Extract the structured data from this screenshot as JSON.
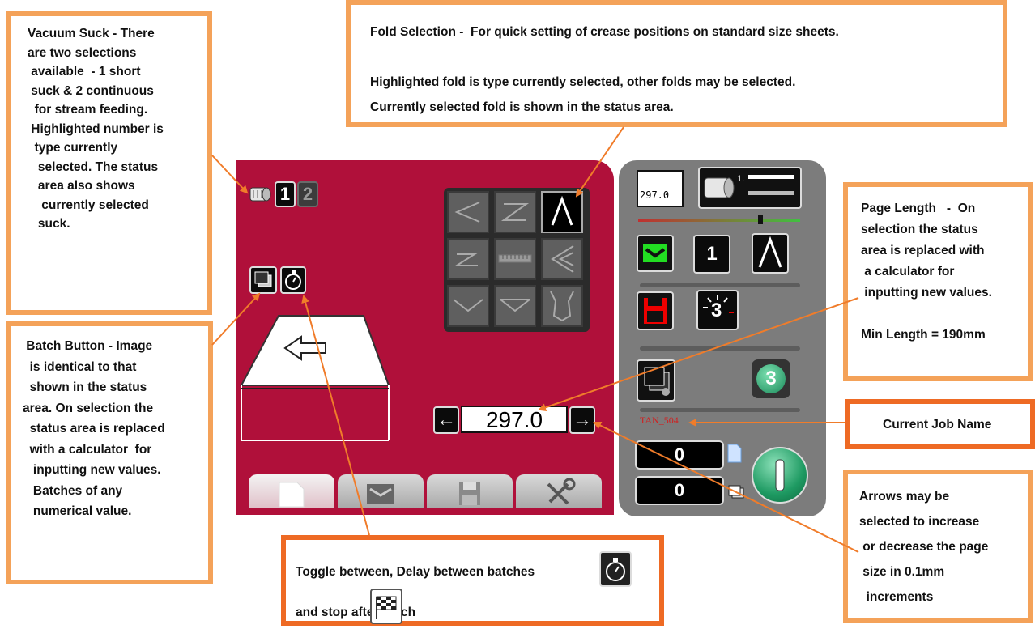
{
  "callouts": {
    "vacuum": {
      "lines": [
        "Vacuum Suck - There",
        "are two selections",
        " available  - 1 short",
        " suck & 2 continuous",
        "  for stream feeding.",
        " Highlighted number is",
        "  type currently",
        "   selected. The status",
        "   area also shows",
        "    currently selected",
        "   suck."
      ]
    },
    "fold": {
      "lines": [
        "Fold Selection -  For quick setting of crease positions on standard size sheets.",
        "",
        "Highlighted fold is type currently selected, other folds may be selected.",
        "Currently selected fold is shown in the status area."
      ]
    },
    "page_length": {
      "lines": [
        "Page Length   -  On",
        "selection the status",
        "area is replaced with",
        " a calculator for",
        " inputting new values.",
        "",
        "Min Length = 190mm"
      ]
    },
    "batch": {
      "lines": [
        " Batch Button - Image",
        "  is identical to that",
        "  shown in the status",
        "area. On selection the",
        "  status area is replaced",
        "  with a calculator  for",
        "   inputting new values.",
        "   Batches of any",
        "   numerical value."
      ]
    },
    "job_name": {
      "text": "Current Job Name"
    },
    "arrows": {
      "lines": [
        "Arrows may be",
        "selected to increase",
        " or decrease the page",
        " size in 0.1mm",
        "  increments"
      ]
    },
    "toggle": {
      "line1": "Toggle between, Delay between batches",
      "line2": "and stop after batch"
    }
  },
  "screen": {
    "suck_options": [
      "1",
      "2"
    ],
    "page_length_value": "297.0",
    "left_arrow": "←",
    "right_arrow": "→"
  },
  "status": {
    "page_length_value": "297.0",
    "batch_count": "1",
    "job_name": "TAN_504",
    "counter_sheets": "0",
    "counter_batches": "0",
    "program_number": "3",
    "batch_set": "3"
  },
  "colors": {
    "screen_bg": "#b0103a",
    "status_bg": "#7c7c7c",
    "callout_border": "#f4a259",
    "leader": "#f07c2a"
  }
}
